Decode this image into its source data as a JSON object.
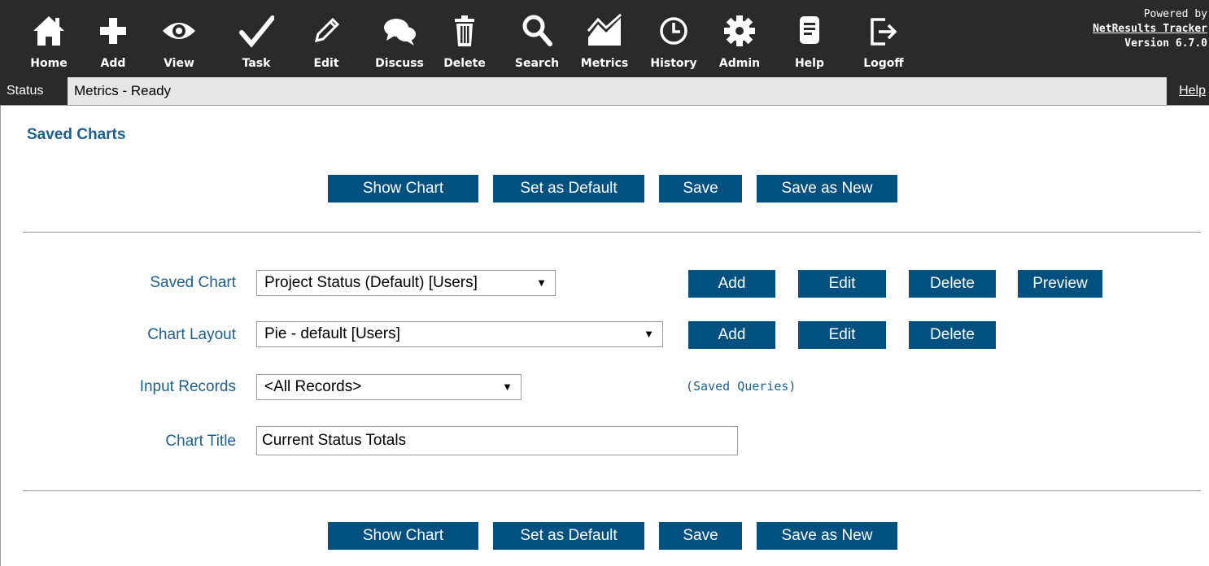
{
  "toolbar": {
    "items": [
      {
        "label": "Home",
        "icon": "home-icon"
      },
      {
        "label": "Add",
        "icon": "plus-icon"
      },
      {
        "label": "View",
        "icon": "eye-icon"
      },
      {
        "label": "Task",
        "icon": "checkmark-icon"
      },
      {
        "label": "Edit",
        "icon": "pencil-icon"
      },
      {
        "label": "Discuss",
        "icon": "chat-bubbles-icon"
      },
      {
        "label": "Delete",
        "icon": "trash-icon"
      },
      {
        "label": "Search",
        "icon": "magnifier-icon"
      },
      {
        "label": "Metrics",
        "icon": "chart-icon"
      },
      {
        "label": "History",
        "icon": "clock-icon"
      },
      {
        "label": "Admin",
        "icon": "gear-icon"
      },
      {
        "label": "Help",
        "icon": "document-icon"
      },
      {
        "label": "Logoff",
        "icon": "logout-icon"
      }
    ],
    "powered_by": "Powered by",
    "product_link": "NetResults Tracker",
    "version": "Version 6.7.0"
  },
  "status": {
    "label": "Status",
    "text": "Metrics - Ready",
    "help": "Help"
  },
  "section_title": "Saved Charts",
  "actions": {
    "show_chart": "Show Chart",
    "set_default": "Set as Default",
    "save": "Save",
    "save_as_new": "Save as New"
  },
  "form": {
    "saved_chart": {
      "label": "Saved Chart",
      "value": "Project Status (Default) [Users]"
    },
    "chart_layout": {
      "label": "Chart Layout",
      "value": "Pie - default [Users]"
    },
    "input_records": {
      "label": "Input Records",
      "value": "<All Records>"
    },
    "chart_title": {
      "label": "Chart Title",
      "value": "Current Status Totals"
    },
    "add": "Add",
    "edit": "Edit",
    "delete": "Delete",
    "preview": "Preview",
    "saved_queries": "(Saved Queries)"
  },
  "colors": {
    "toolbar_bg": "#2a2a2a",
    "button_bg": "#00517f",
    "label_text": "#1f5f8b"
  }
}
